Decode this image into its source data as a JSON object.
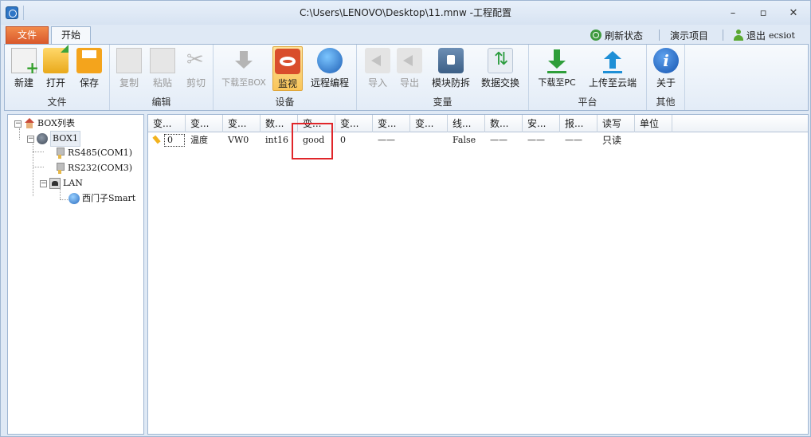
{
  "window": {
    "title": "C:\\Users\\LENOVO\\Desktop\\11.mnw  -工程配置"
  },
  "tabs": {
    "file": "文件",
    "start": "开始"
  },
  "top_actions": {
    "refresh": "刷新状态",
    "demo": "演示项目",
    "logout": "退出",
    "username": "ecsiot"
  },
  "ribbon": {
    "file_group": {
      "label": "文件",
      "new": "新建",
      "open": "打开",
      "save": "保存"
    },
    "edit_group": {
      "label": "编辑",
      "copy": "复制",
      "paste": "粘贴",
      "cut": "剪切"
    },
    "device_group": {
      "label": "设备",
      "download_box": "下载至BOX",
      "monitor": "监视",
      "remote": "远程编程"
    },
    "variable_group": {
      "label": "变量",
      "import": "导入",
      "export": "导出",
      "module_protect": "模块防拆",
      "data_exchange": "数据交换"
    },
    "platform_group": {
      "label": "平台",
      "download_pc": "下载至PC",
      "upload_cloud": "上传至云端"
    },
    "other_group": {
      "label": "其他",
      "about": "关于"
    }
  },
  "tree": {
    "root": "BOX列表",
    "box": "BOX1",
    "rs485": "RS485(COM1)",
    "rs232": "RS232(COM3)",
    "lan": "LAN",
    "plc": "西门子Smart"
  },
  "grid": {
    "columns": [
      "变...",
      "变...",
      "变...",
      "数...",
      "变...",
      "变...",
      "变...",
      "变...",
      "线...",
      "数...",
      "安...",
      "报...",
      "读写",
      "单位"
    ],
    "rows": [
      {
        "c0": "0",
        "c1": "温度",
        "c2": "VW0",
        "c3": "int16",
        "c4": "good",
        "c5": "0",
        "c6": "——",
        "c7": "",
        "c8": "False",
        "c9": "——",
        "c10": "——",
        "c11": "——",
        "c12": "只读",
        "c13": ""
      }
    ]
  }
}
